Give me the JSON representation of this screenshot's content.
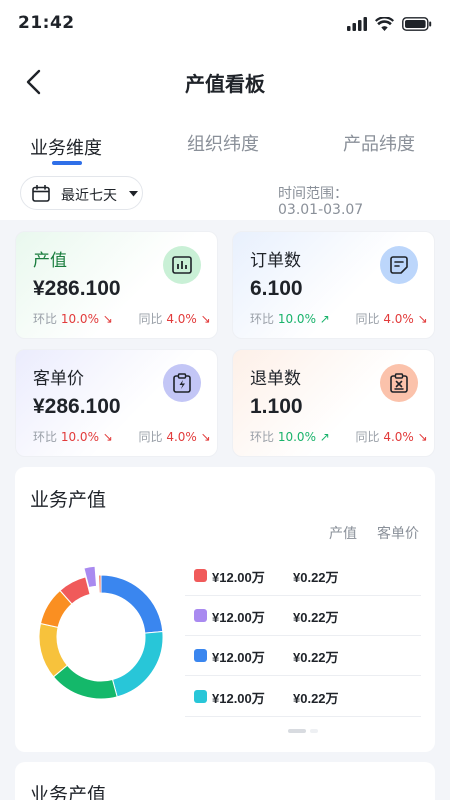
{
  "status_bar": {
    "time": "21:42"
  },
  "header": {
    "title": "产值看板"
  },
  "tabs": [
    {
      "label": "业务维度",
      "active": true
    },
    {
      "label": "组织纬度",
      "active": false
    },
    {
      "label": "产品纬度",
      "active": false
    }
  ],
  "filter": {
    "label": "最近七天"
  },
  "time_range": {
    "label": "时间范围：",
    "value": "03.01-03.07"
  },
  "cards": [
    {
      "title": "产值",
      "value": "¥286.100",
      "mom_label": "环比",
      "mom_value": "10.0%",
      "mom_dir": "down",
      "yoy_label": "同比",
      "yoy_value": "4.0%",
      "yoy_dir": "down",
      "icon": "bar-chart-icon",
      "accent": "#2e9e5b"
    },
    {
      "title": "订单数",
      "value": "6.100",
      "mom_label": "环比",
      "mom_value": "10.0%",
      "mom_dir": "up",
      "yoy_label": "同比",
      "yoy_value": "4.0%",
      "yoy_dir": "down",
      "icon": "note-icon",
      "accent": "#3b78e7"
    },
    {
      "title": "客单价",
      "value": "¥286.100",
      "mom_label": "环比",
      "mom_value": "10.0%",
      "mom_dir": "down",
      "yoy_label": "同比",
      "yoy_value": "4.0%",
      "yoy_dir": "down",
      "icon": "clipboard-bolt-icon",
      "accent": "#5b5fd8"
    },
    {
      "title": "退单数",
      "value": "1.100",
      "mom_label": "环比",
      "mom_value": "10.0%",
      "mom_dir": "up",
      "yoy_label": "同比",
      "yoy_value": "4.0%",
      "yoy_dir": "down",
      "icon": "clipboard-x-icon",
      "accent": "#e07a4a"
    }
  ],
  "colors": {
    "up": "#19b36b",
    "down": "#e23b3b",
    "primary": "#2f6fe8"
  },
  "panel": {
    "title": "业务产值",
    "col_headers": [
      "产值",
      "客单价"
    ],
    "legend": [
      {
        "value": "¥12.00万",
        "price": "¥0.22万",
        "color": "#f05a5a"
      },
      {
        "value": "¥12.00万",
        "price": "¥0.22万",
        "color": "#a98af0"
      },
      {
        "value": "¥12.00万",
        "price": "¥0.22万",
        "color": "#3a86ef"
      },
      {
        "value": "¥12.00万",
        "price": "¥0.22万",
        "color": "#28c6d8"
      }
    ]
  },
  "chart_data": {
    "type": "pie",
    "categories": [
      "",
      "",
      "",
      "",
      "",
      "",
      "",
      "",
      ""
    ],
    "values": [
      23.6,
      22.2,
      18.1,
      14.6,
      10,
      7.5,
      2.8,
      0.6,
      0.6
    ],
    "colors": [
      "#3a86ef",
      "#28c6d8",
      "#14b86a",
      "#f7c23c",
      "#fa8f21",
      "#f05a5a",
      "#a98af0",
      "#ffffff",
      "#ef6c56"
    ],
    "highlight_index": 6
  },
  "panel2": {
    "title": "业务产值"
  }
}
